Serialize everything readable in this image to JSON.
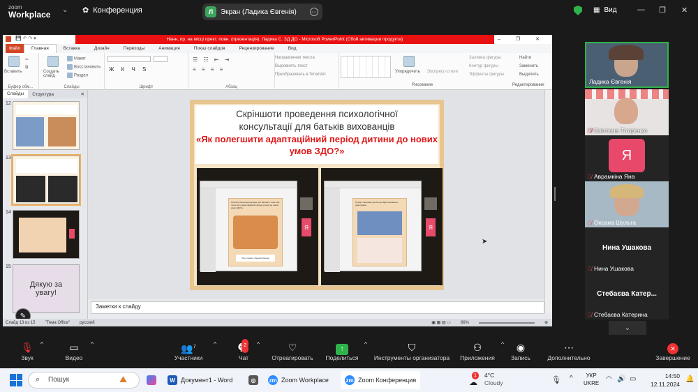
{
  "zoom": {
    "logo_line1": "zoom",
    "logo_line2": "Workplace",
    "conference_label": "Конференция",
    "screen_share_label": "Экран (Ладика Євгенія)",
    "screen_avatar_letter": "Л",
    "view_label": "Вид"
  },
  "ppt": {
    "title": "Нанн, пр. на місці прект. повн. (презентація). Ладика С. ЗД ДО - Microsoft PowerPoint (Сбой активации продукта)",
    "file_tab": "Файл",
    "tabs": [
      "Главная",
      "Вставка",
      "Дизайн",
      "Переходы",
      "Анимация",
      "Показ слайдов",
      "Рецензирование",
      "Вид"
    ],
    "ribbon": {
      "paste": "Вставить",
      "create_slide": "Создать слайд",
      "layout": "Макет",
      "reset": "Восстановить",
      "section": "Раздел",
      "clipboard": "Буфер обм...",
      "slides": "Слайды",
      "font": "Шрифт",
      "paragraph": "Абзац",
      "text_direction": "Направление текста",
      "align_text": "Выровнять текст",
      "convert_smartart": "Преобразовать в SmartArt",
      "arrange": "Упорядочить",
      "quick_styles": "Экспресс-стили",
      "fill": "Заливка фигуры",
      "outline": "Контур фигуры",
      "effects": "Эффекты фигуры",
      "drawing": "Рисование",
      "find": "Найти",
      "replace": "Заменить",
      "select": "Выделить",
      "editing": "Редактирование"
    },
    "panel_tabs": [
      "Слайды",
      "Структура"
    ],
    "thumbs": [
      {
        "num": "12"
      },
      {
        "num": "13"
      },
      {
        "num": "14"
      },
      {
        "num": "15",
        "text": "Дякую за увагу!"
      }
    ],
    "slide": {
      "title_line1": "Скріншоти проведення психологічної",
      "title_line2": "консультації для батьків вихованців",
      "subtitle": "«Як полегшити адаптаційний період дитини до нових умов ЗДО?»",
      "left_card_title": "Психологічна консультація для батьків з теми «Як полегшити адаптаційний період дитини до нових умов ЗДО?»",
      "left_card_caption": "Підготувала: Ладика Євгенія",
      "right_card_title": "Процес звикання дитини до ЗДО називають адаптацією",
      "ya": "Я"
    },
    "notes_placeholder": "Заметки к слайду",
    "status": {
      "slide_of": "Слайд 13 из 15",
      "theme": "\"Тема Office\"",
      "lang": "русский",
      "zoom": "66%"
    }
  },
  "participants": [
    {
      "name": "Ладика Євгенія",
      "muted": false
    },
    {
      "name": "Світлана Тітаренко",
      "muted": true
    },
    {
      "name": "Аврамкіна Яна",
      "muted": true,
      "avatar": "Я"
    },
    {
      "name": "Оксана Шульга",
      "muted": true
    },
    {
      "name": "Нина Ушакова",
      "muted": true,
      "big_name": "Нина Ушакова"
    },
    {
      "name": "Стебаєва Катерина",
      "muted": true,
      "big_name": "Стебаєва Катер..."
    }
  ],
  "controls": {
    "audio": "Звук",
    "video": "Видео",
    "participants": "Участники",
    "participants_count": "7",
    "chat": "Чат",
    "chat_badge": "2",
    "react": "Отреагировать",
    "share": "Поделиться",
    "host_tools": "Инструменты организатора",
    "apps": "Приложения",
    "record": "Запись",
    "more": "Дополнительно",
    "end": "Завершение"
  },
  "taskbar": {
    "search": "Пошук",
    "word": "Документ1 - Word",
    "zoom_workplace": "Zoom Workplace",
    "zoom_conf": "Zoom Конференция",
    "weather_temp": "4°C",
    "weather_desc": "Cloudy",
    "weather_badge": "1",
    "lang1": "УКР",
    "lang2": "UKRE",
    "time": "14:50",
    "date": "12.11.2024"
  }
}
